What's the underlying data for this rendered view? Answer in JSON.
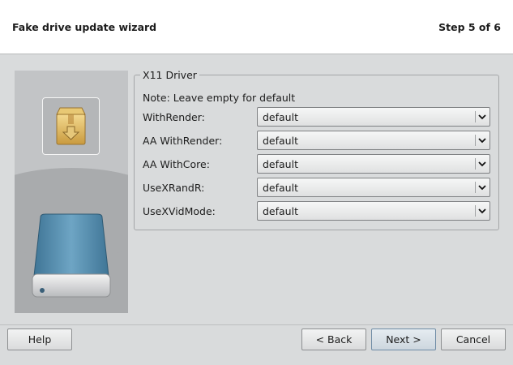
{
  "header": {
    "title": "Fake drive update wizard",
    "step": "Step 5 of 6"
  },
  "group": {
    "legend": "X11 Driver",
    "note": "Note: Leave empty for default"
  },
  "rows": [
    {
      "label": "WithRender:",
      "value": "default"
    },
    {
      "label": "AA WithRender:",
      "value": "default"
    },
    {
      "label": "AA WithCore:",
      "value": "default"
    },
    {
      "label": "UseXRandR:",
      "value": "default"
    },
    {
      "label": "UseXVidMode:",
      "value": "default"
    }
  ],
  "buttons": {
    "help": "Help",
    "back": "< Back",
    "next": "Next >",
    "cancel": "Cancel"
  },
  "icons": {
    "package": "package-install-icon",
    "disk": "hard-drive-icon",
    "dropdown": "chevron-down-icon"
  },
  "colors": {
    "header_bg": "#ffffff",
    "body_bg": "#d9dbdc",
    "sidebar_bg": "#a9abad",
    "disk_blue": "#4f88a8"
  }
}
